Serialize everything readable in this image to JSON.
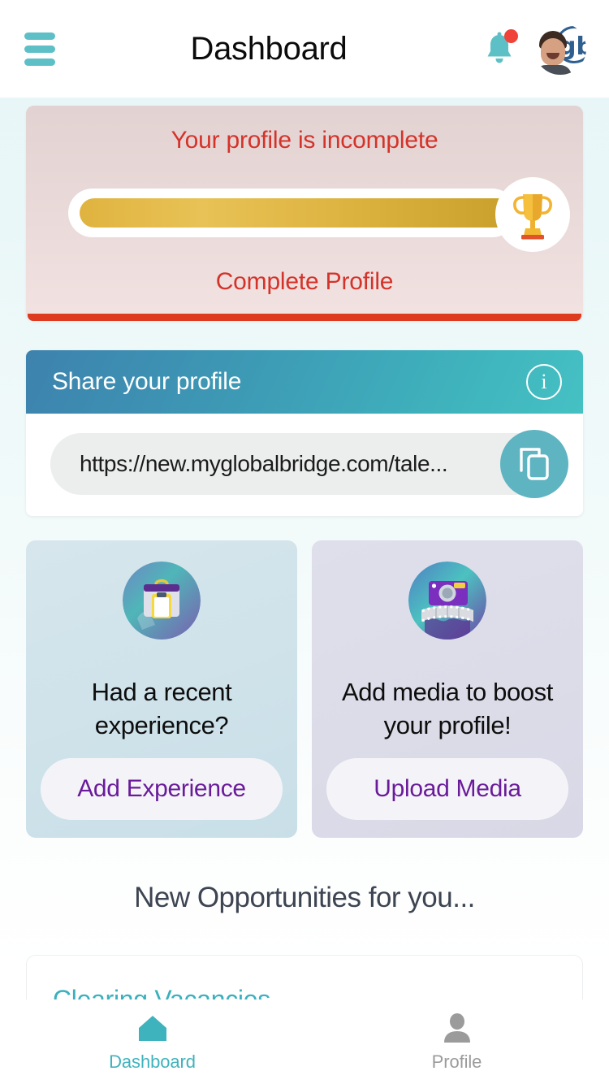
{
  "header": {
    "title": "Dashboard",
    "menu_icon": "hamburger-menu-icon",
    "bell_icon": "notification-bell-icon",
    "bell_has_badge": true,
    "avatar_icon": "user-avatar",
    "avatar_logo_text": "gb"
  },
  "profile_card": {
    "title": "Your profile is incomplete",
    "cta_label": "Complete Profile",
    "progress_percent": 99,
    "trophy_icon": "trophy-icon",
    "accent_color": "#d4332a",
    "underline_color": "#dd3a20",
    "background_color": "#e8dad9"
  },
  "share_card": {
    "title": "Share your profile",
    "info_icon": "info-icon",
    "info_glyph": "i",
    "url": "https://new.myglobalbridge.com/tale...",
    "copy_icon": "copy-icon",
    "header_gradient_from": "#3d82ae",
    "header_gradient_to": "#45c1c3",
    "copy_button_color": "#5fb4c2"
  },
  "action_cards": [
    {
      "id": "experience",
      "icon": "briefcase-clipboard-icon",
      "title": "Had a recent experience?",
      "button_label": "Add Experience",
      "background_color": "#cfe2ea",
      "button_text_color": "#6a1b9a"
    },
    {
      "id": "media",
      "icon": "camera-film-icon",
      "title": "Add media to boost your profile!",
      "button_label": "Upload Media",
      "background_color": "#dcdce9",
      "button_text_color": "#6a1b9a"
    }
  ],
  "opportunities": {
    "section_title": "New Opportunities for you...",
    "cards": [
      {
        "title": "Clearing Vacancies",
        "title_color": "#3bb0bd"
      }
    ]
  },
  "bottom_nav": {
    "items": [
      {
        "label": "Dashboard",
        "icon": "home-icon",
        "active": true,
        "color": "#3fb3bd"
      },
      {
        "label": "Profile",
        "icon": "person-icon",
        "active": false,
        "color": "#9b9b9b"
      }
    ]
  }
}
